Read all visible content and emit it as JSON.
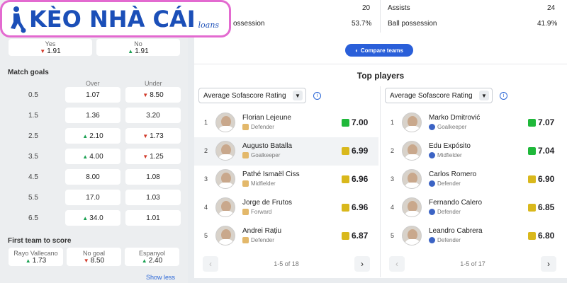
{
  "logo": {
    "text": "KÈO NHÀ CÁI",
    "subtext": "loans"
  },
  "left": {
    "yesno": [
      {
        "label": "Yes",
        "value": "1.91",
        "trend": "down"
      },
      {
        "label": "No",
        "value": "1.91",
        "trend": "up"
      }
    ],
    "match_goals_title": "Match goals",
    "over_label": "Over",
    "under_label": "Under",
    "goal_rows": [
      {
        "line": "0.5",
        "over": "1.07",
        "over_trend": "",
        "under": "8.50",
        "under_trend": "down"
      },
      {
        "line": "1.5",
        "over": "1.36",
        "over_trend": "",
        "under": "3.20",
        "under_trend": ""
      },
      {
        "line": "2.5",
        "over": "2.10",
        "over_trend": "up",
        "under": "1.73",
        "under_trend": "down"
      },
      {
        "line": "3.5",
        "over": "4.00",
        "over_trend": "up",
        "under": "1.25",
        "under_trend": "down"
      },
      {
        "line": "4.5",
        "over": "8.00",
        "over_trend": "",
        "under": "1.08",
        "under_trend": ""
      },
      {
        "line": "5.5",
        "over": "17.0",
        "over_trend": "",
        "under": "1.03",
        "under_trend": ""
      },
      {
        "line": "6.5",
        "over": "34.0",
        "over_trend": "up",
        "under": "1.01",
        "under_trend": ""
      }
    ],
    "first_team_title": "First team to score",
    "first_team": [
      {
        "label": "Rayo Vallecano",
        "value": "1.73",
        "trend": "up"
      },
      {
        "label": "No goal",
        "value": "8.50",
        "trend": "down"
      },
      {
        "label": "Espanyol",
        "value": "2.40",
        "trend": "up"
      }
    ],
    "show_less": "Show less"
  },
  "stats": {
    "left_value_1": "20",
    "left_label_2": "ossession",
    "left_value_2": "53.7%",
    "right_label_1": "Assists",
    "right_value_1": "24",
    "right_label_2": "Ball possession",
    "right_value_2": "41.9%"
  },
  "compare_button": "Compare teams",
  "top_players_title": "Top players",
  "columns": [
    {
      "select_label": "Average Sofascore Rating",
      "team": "rayo",
      "pager": "1-5 of 18",
      "players": [
        {
          "rank": "1",
          "name": "Florian Lejeune",
          "position": "Defender",
          "rating": "7.00",
          "color": "#1fb83a"
        },
        {
          "rank": "2",
          "name": "Augusto Batalla",
          "position": "Goalkeeper",
          "rating": "6.99",
          "color": "#d9b81c"
        },
        {
          "rank": "3",
          "name": "Pathé Ismaël Ciss",
          "position": "Midfielder",
          "rating": "6.96",
          "color": "#d9b81c"
        },
        {
          "rank": "4",
          "name": "Jorge de Frutos",
          "position": "Forward",
          "rating": "6.96",
          "color": "#d9b81c"
        },
        {
          "rank": "5",
          "name": "Andrei Rațiu",
          "position": "Defender",
          "rating": "6.87",
          "color": "#d9b81c"
        }
      ]
    },
    {
      "select_label": "Average Sofascore Rating",
      "team": "espanyol",
      "pager": "1-5 of 17",
      "players": [
        {
          "rank": "1",
          "name": "Marko Dmitrović",
          "position": "Goalkeeper",
          "rating": "7.07",
          "color": "#1fb83a"
        },
        {
          "rank": "2",
          "name": "Edu Expósito",
          "position": "Midfielder",
          "rating": "7.04",
          "color": "#1fb83a"
        },
        {
          "rank": "3",
          "name": "Carlos Romero",
          "position": "Defender",
          "rating": "6.90",
          "color": "#d9b81c"
        },
        {
          "rank": "4",
          "name": "Fernando Calero",
          "position": "Defender",
          "rating": "6.85",
          "color": "#d9b81c"
        },
        {
          "rank": "5",
          "name": "Leandro Cabrera",
          "position": "Defender",
          "rating": "6.80",
          "color": "#d9b81c"
        }
      ]
    }
  ]
}
